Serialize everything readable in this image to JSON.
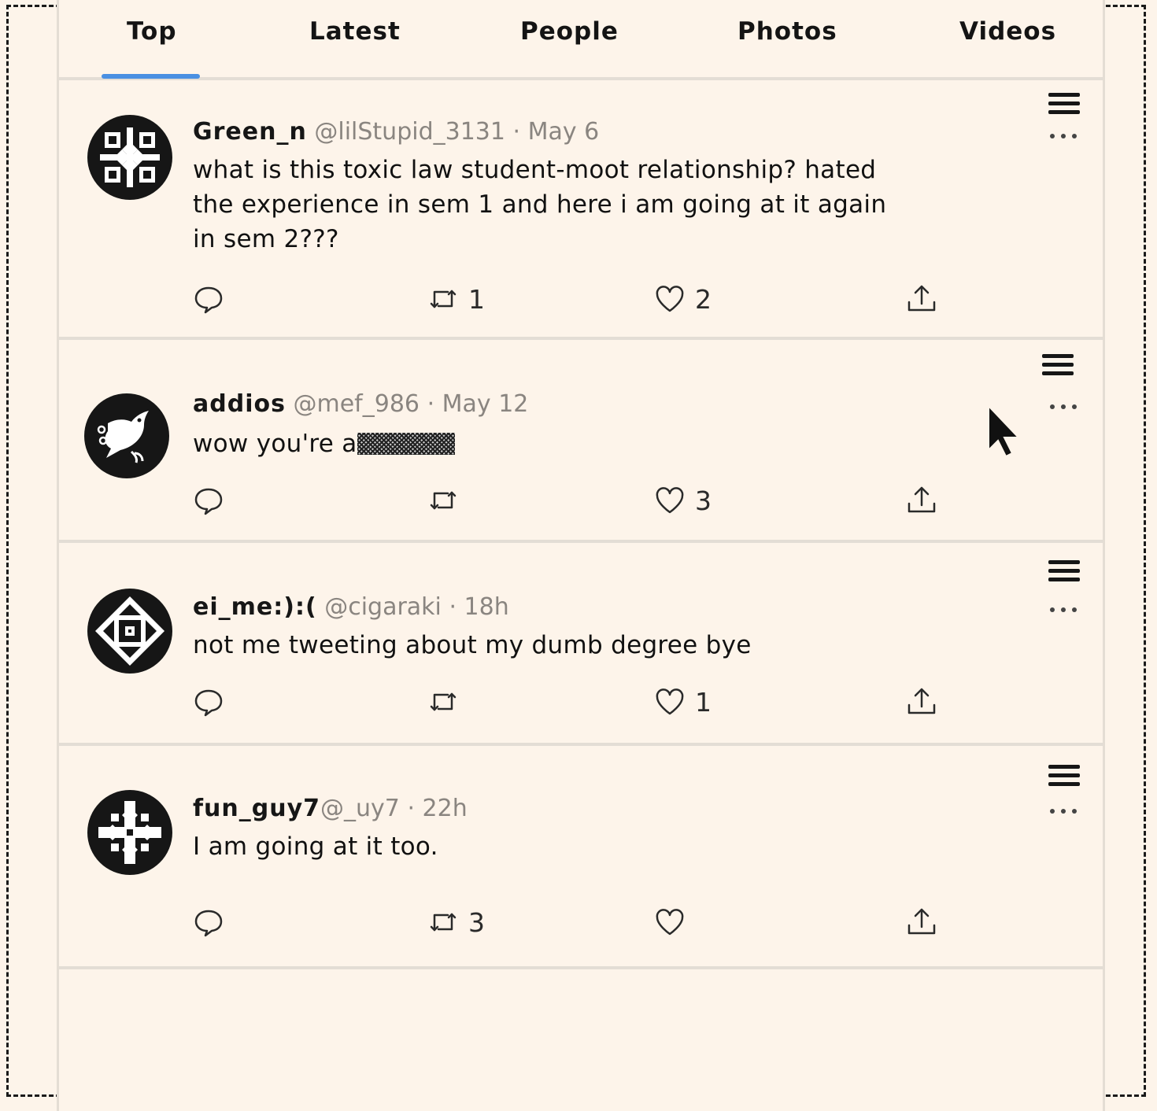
{
  "tabs": [
    {
      "label": "Top",
      "active": true
    },
    {
      "label": "Latest"
    },
    {
      "label": "People"
    },
    {
      "label": "Photos"
    },
    {
      "label": "Videos"
    }
  ],
  "accent_color": "#4a90e2",
  "tweets": [
    {
      "name": "Green_n",
      "handle": "@lilStupid_3131",
      "time": "May 6",
      "text": "what is this toxic law student-moot relationship? hated the experience in sem 1 and here i am going at it again in sem 2???",
      "reply_count": "",
      "retweet_count": "1",
      "like_count": "2",
      "avatar_icon": "snowflake-pattern-icon"
    },
    {
      "name": "addios",
      "handle": "@mef_986",
      "time": "May 12",
      "text": "wow you're a",
      "redacted": true,
      "reply_count": "",
      "retweet_count": "",
      "like_count": "3",
      "avatar_icon": "bird-icon"
    },
    {
      "name": "ei_me:):(",
      "handle": "@cigaraki",
      "time": "18h",
      "text": "not me tweeting about my dumb degree bye",
      "reply_count": "",
      "retweet_count": "",
      "like_count": "1",
      "avatar_icon": "diamond-pattern-icon"
    },
    {
      "name": "fun_guy7",
      "handle": "@_uy7",
      "time": "22h",
      "text": "I am going at it too.",
      "reply_count": "",
      "retweet_count": "3",
      "like_count": "",
      "avatar_icon": "cross-pattern-icon"
    }
  ]
}
